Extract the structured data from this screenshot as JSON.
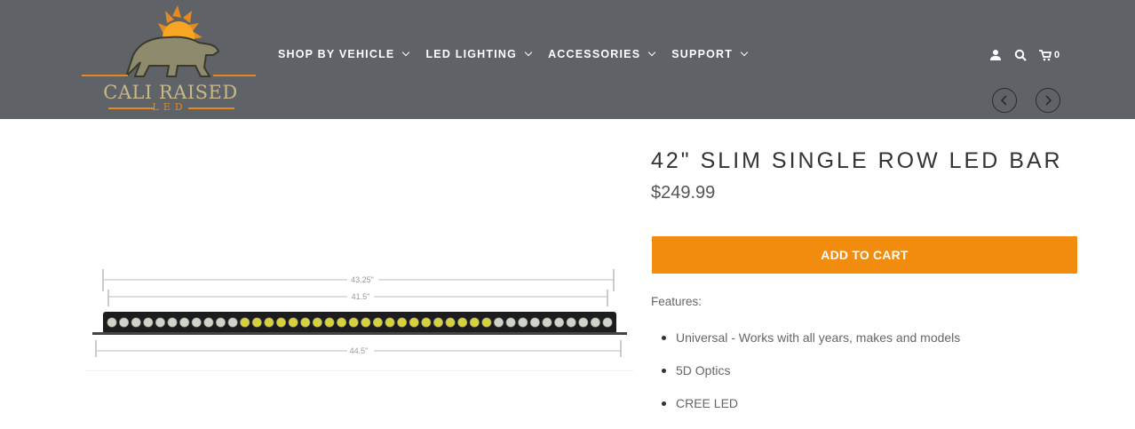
{
  "brand": {
    "name": "CALI RAISED",
    "sub": "LED",
    "colors": {
      "header_bg": "#5f6266",
      "accent": "#f28c0f",
      "logo_text": "#c8b98a"
    }
  },
  "nav": {
    "items": [
      {
        "label": "SHOP BY VEHICLE"
      },
      {
        "label": "LED LIGHTING"
      },
      {
        "label": "ACCESSORIES"
      },
      {
        "label": "SUPPORT"
      }
    ]
  },
  "header_icons": {
    "account": "user-icon",
    "search": "search-icon",
    "cart": "cart-icon",
    "cart_count": "0"
  },
  "pager": {
    "prev": "chevron-left-icon",
    "next": "chevron-right-icon"
  },
  "product": {
    "title": "42\" SLIM SINGLE ROW LED BAR",
    "price": "$249.99",
    "add_to_cart": "ADD TO CART",
    "features_label": "Features:",
    "features": [
      "Universal - Works with all years, makes and models",
      "5D Optics",
      "CREE LED"
    ],
    "image": {
      "dims": {
        "overall": "43.25\"",
        "inner": "41.5\"",
        "mount": "44.5\""
      }
    }
  }
}
